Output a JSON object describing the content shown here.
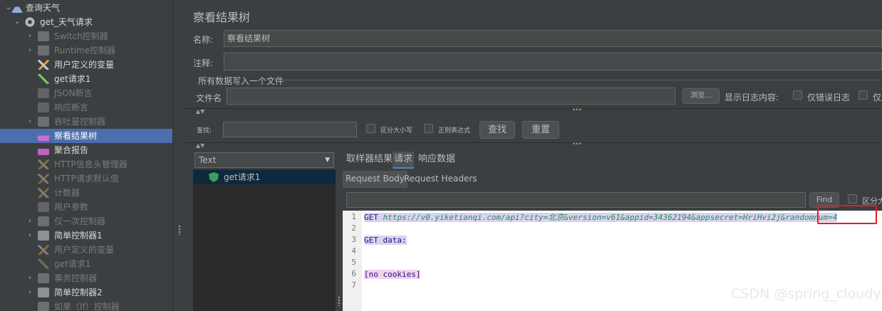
{
  "tree": {
    "items": [
      {
        "label": "查询天气",
        "indent": 0,
        "arrow": "⌄",
        "icon": "flask",
        "dim": false,
        "selected": false
      },
      {
        "label": "get_天气请求",
        "indent": 1,
        "arrow": "⌄",
        "icon": "gear",
        "dim": false,
        "selected": false
      },
      {
        "label": "Switch控制器",
        "indent": 2,
        "arrow": "›",
        "icon": "ctl",
        "dim": true,
        "selected": false
      },
      {
        "label": "Runtime控制器",
        "indent": 2,
        "arrow": "›",
        "icon": "ctl",
        "dim": true,
        "selected": false
      },
      {
        "label": "用户定义的变量",
        "indent": 2,
        "arrow": "",
        "icon": "tool",
        "dim": false,
        "selected": false
      },
      {
        "label": "get请求1",
        "indent": 2,
        "arrow": "",
        "icon": "pen",
        "dim": false,
        "selected": false
      },
      {
        "label": "JSON断言",
        "indent": 2,
        "arrow": "",
        "icon": "doc",
        "dim": true,
        "selected": false
      },
      {
        "label": "响应断言",
        "indent": 2,
        "arrow": "",
        "icon": "doc",
        "dim": true,
        "selected": false
      },
      {
        "label": "吞吐量控制器",
        "indent": 2,
        "arrow": "›",
        "icon": "ctl",
        "dim": true,
        "selected": false
      },
      {
        "label": "察看结果树",
        "indent": 2,
        "arrow": "",
        "icon": "chart",
        "dim": false,
        "selected": true
      },
      {
        "label": "聚合报告",
        "indent": 2,
        "arrow": "",
        "icon": "chart2",
        "dim": false,
        "selected": false
      },
      {
        "label": "HTTP信息头管理器",
        "indent": 2,
        "arrow": "",
        "icon": "tool-dim",
        "dim": true,
        "selected": false
      },
      {
        "label": "HTTP请求默认值",
        "indent": 2,
        "arrow": "",
        "icon": "tool-dim",
        "dim": true,
        "selected": false
      },
      {
        "label": "计数器",
        "indent": 2,
        "arrow": "",
        "icon": "tool-dim",
        "dim": true,
        "selected": false
      },
      {
        "label": "用户参数",
        "indent": 2,
        "arrow": "",
        "icon": "doc",
        "dim": true,
        "selected": false
      },
      {
        "label": "仅一次控制器",
        "indent": 2,
        "arrow": "›",
        "icon": "ctl",
        "dim": true,
        "selected": false
      },
      {
        "label": "简单控制器1",
        "indent": 2,
        "arrow": "›",
        "icon": "ctl-on",
        "dim": false,
        "selected": false
      },
      {
        "label": "用户定义的变量",
        "indent": 2,
        "arrow": "",
        "icon": "tool-dim",
        "dim": true,
        "selected": false
      },
      {
        "label": "get请求1",
        "indent": 2,
        "arrow": "",
        "icon": "pen-dim",
        "dim": true,
        "selected": false
      },
      {
        "label": "事务控制器",
        "indent": 2,
        "arrow": "›",
        "icon": "ctl",
        "dim": true,
        "selected": false
      },
      {
        "label": "简单控制器2",
        "indent": 2,
        "arrow": "›",
        "icon": "ctl-on",
        "dim": false,
        "selected": false
      },
      {
        "label": "如果（If）控制器",
        "indent": 2,
        "arrow": "",
        "icon": "ctl",
        "dim": true,
        "selected": false
      }
    ]
  },
  "panel": {
    "title": "察看结果树",
    "name_label": "名称:",
    "name_value": "察看结果树",
    "comment_label": "注释:",
    "comment_value": "",
    "file_section_label": "所有数据写入一个文件",
    "filename_label": "文件名",
    "filename_value": "",
    "browse_label": "浏览...",
    "log_display_label": "显示日志内容:",
    "errors_only_label": "仅错误日志",
    "success_only_label": "仅成功日志",
    "search_label": "查找:",
    "search_value": "",
    "case_label": "区分大小写",
    "regex_label": "正则表达式",
    "find_btn": "查找",
    "reset_btn": "重置"
  },
  "results": {
    "renderer": "Text",
    "samples": [
      "get请求1"
    ],
    "tabs": [
      "取样器结果",
      "请求",
      "响应数据"
    ],
    "active_tab": "请求",
    "subtabs": [
      "Request Body",
      "Request Headers"
    ],
    "active_subtab": "Request Body",
    "find_value": "",
    "find_btn": "Find",
    "case_label": "区分大小写"
  },
  "editor": {
    "line_numbers": [
      "1",
      "2",
      "3",
      "4",
      "5",
      "6",
      "7"
    ],
    "line1_method": "GET ",
    "line1_url": "https://v0.yiketianqi.com/api?city=北京&version=v61&appid=34362194&appsecret=HriHvi2j&randomnum=4",
    "line3": "GET data:",
    "line6": "[no cookies]"
  },
  "watermark": "CSDN @spring_cloudy",
  "colors": {
    "selection": "#4b6eaf",
    "highlight": "#d9d2f0",
    "redbox": "#e02020"
  }
}
